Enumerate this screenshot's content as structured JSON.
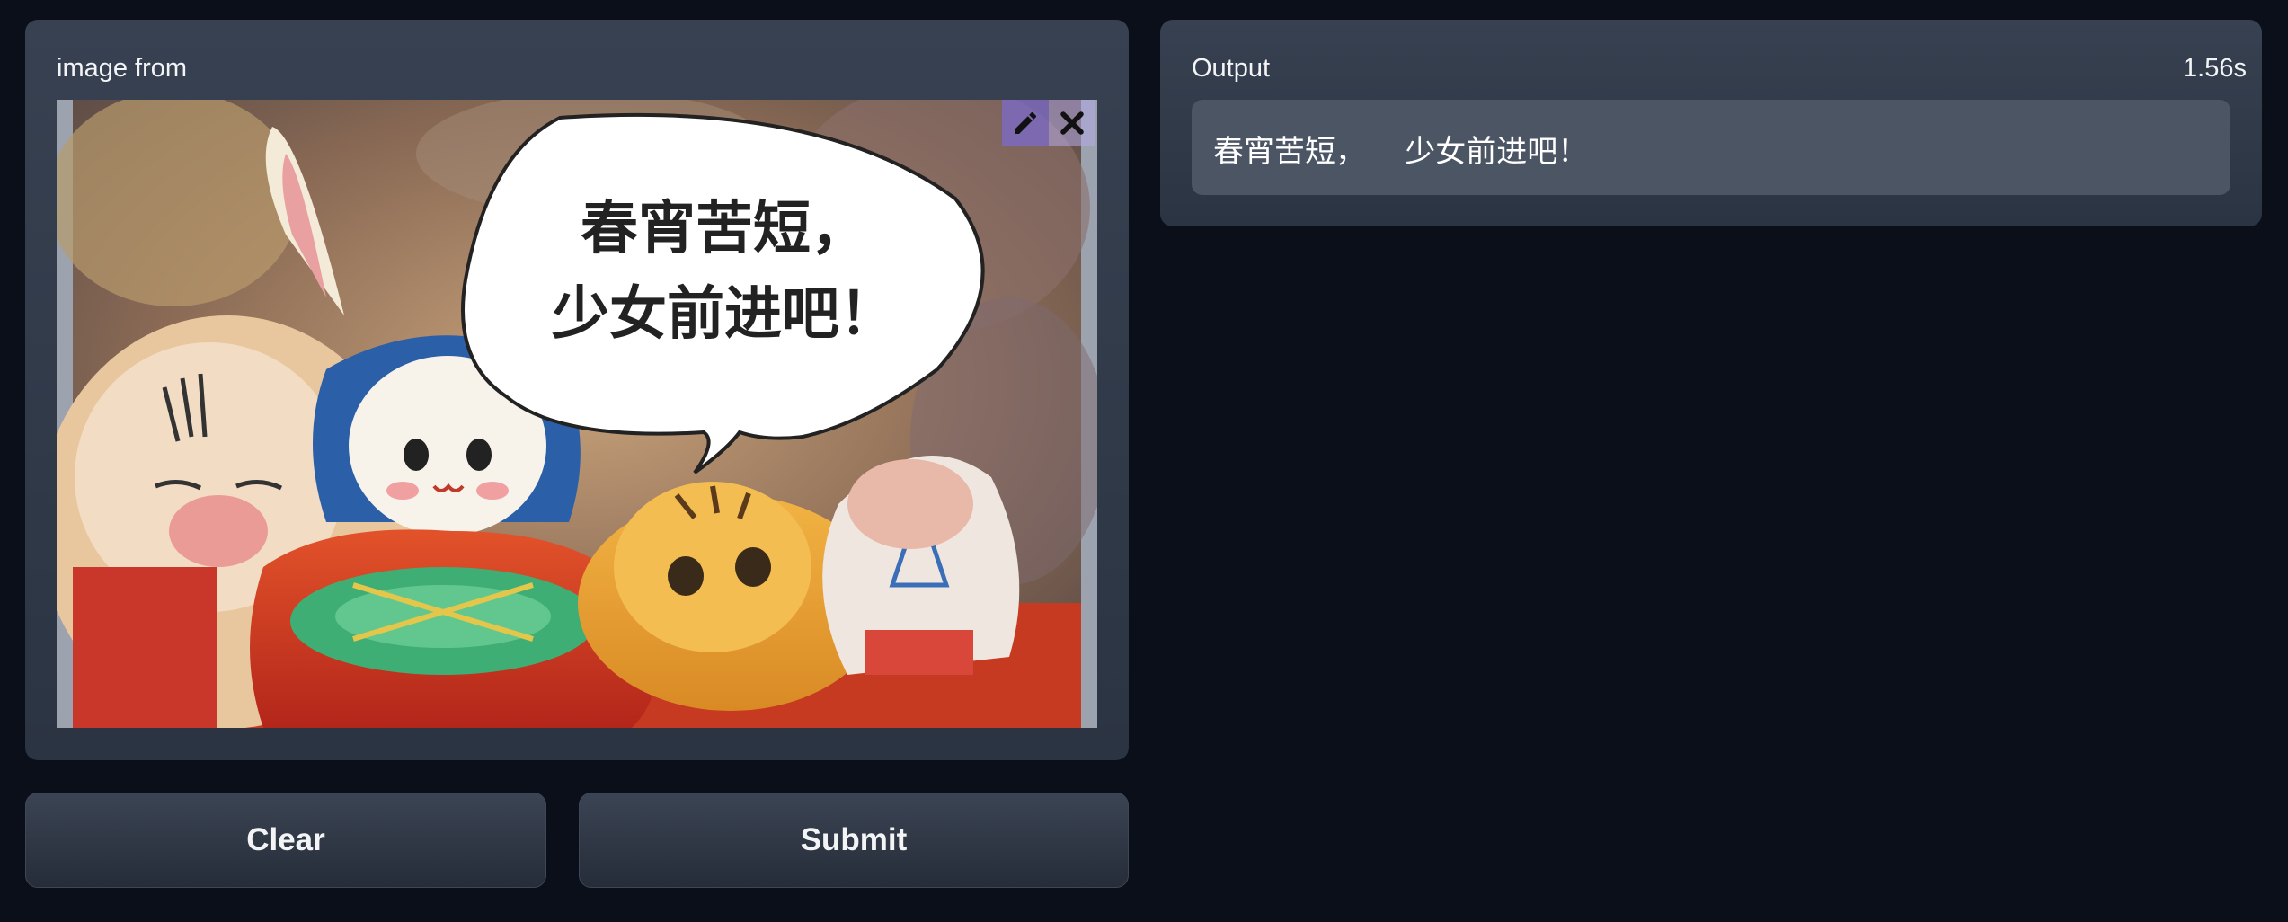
{
  "input_panel": {
    "label": "image from",
    "image": {
      "speech_bubble_line1": "春宵苦短，",
      "speech_bubble_line2": "少女前进吧！",
      "edit_icon": "pencil-icon",
      "clear_icon": "close-icon"
    }
  },
  "output_panel": {
    "label": "Output",
    "timer": "1.56s",
    "text": "春宵苦短，    少女前进吧！"
  },
  "buttons": {
    "clear_label": "Clear",
    "submit_label": "Submit"
  },
  "colors": {
    "background": "#0b0f19",
    "panel": "#374151",
    "textbox": "#4b5563",
    "edit_accent": "#7c6ac6"
  }
}
